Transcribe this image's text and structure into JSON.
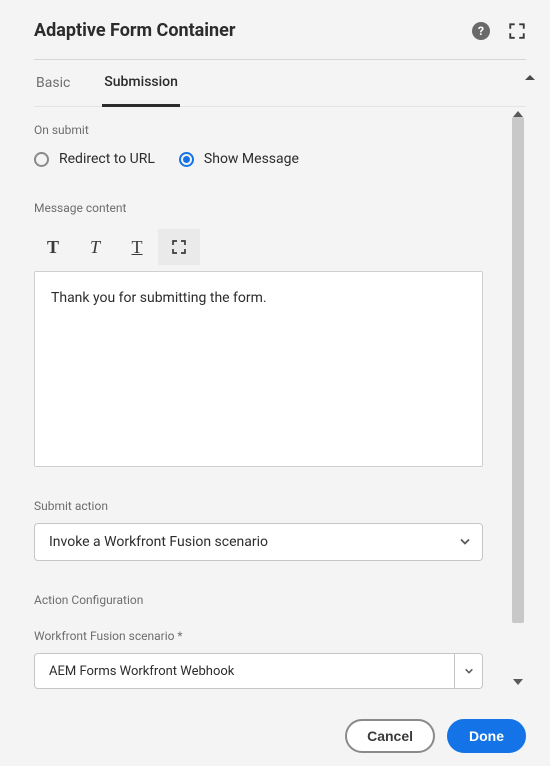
{
  "header": {
    "title": "Adaptive Form Container"
  },
  "tabs": {
    "basic": "Basic",
    "submission": "Submission"
  },
  "onsubmit": {
    "label": "On submit",
    "redirect_label": "Redirect to URL",
    "message_label": "Show Message"
  },
  "message": {
    "label": "Message content",
    "value": "Thank you for submitting the form."
  },
  "submit_action": {
    "label": "Submit action",
    "value": "Invoke a Workfront Fusion scenario"
  },
  "action_config": {
    "label": "Action Configuration",
    "scenario_label": "Workfront Fusion scenario *",
    "scenario_value": "AEM Forms Workfront Webhook"
  },
  "footer": {
    "cancel": "Cancel",
    "done": "Done"
  }
}
